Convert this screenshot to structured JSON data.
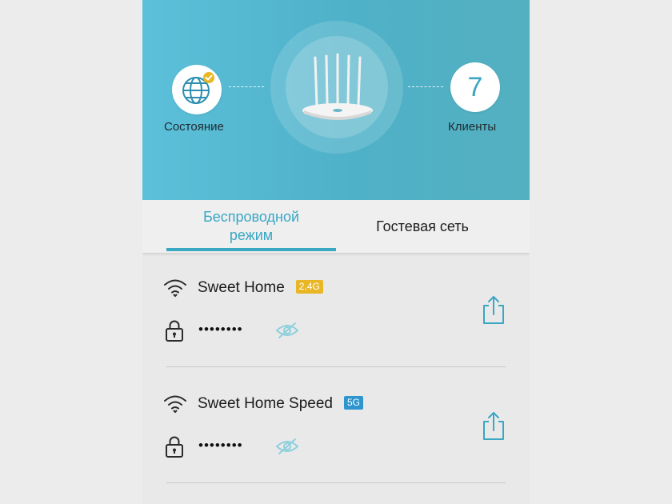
{
  "hero": {
    "status_label": "Состояние",
    "clients_label": "Клиенты",
    "clients_count": "7",
    "icons": {
      "status": "globe-check-icon",
      "router": "router-image"
    }
  },
  "tabs": [
    {
      "label": "Беспроводной режим",
      "active": true
    },
    {
      "label": "Гостевая сеть",
      "active": false
    }
  ],
  "networks": [
    {
      "ssid": "Sweet Home",
      "band": "2.4G",
      "band_color": "#e9b625",
      "password_masked": "••••••••"
    },
    {
      "ssid": "Sweet Home Speed",
      "band": "5G",
      "band_color": "#2f95cf",
      "password_masked": "••••••••"
    }
  ],
  "colors": {
    "accent": "#3aa7c3",
    "hero_gradient_start": "#5cc0da",
    "hero_gradient_end": "#53b0c0"
  }
}
